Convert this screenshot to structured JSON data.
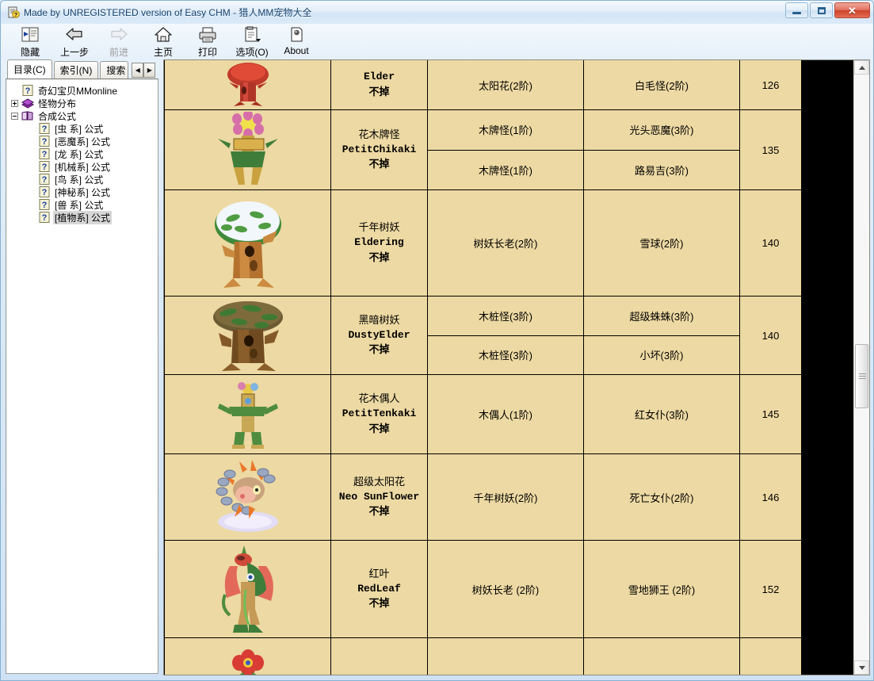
{
  "window": {
    "title": "Made by UNREGISTERED version of Easy CHM - 猎人MM宠物大全",
    "icon": "chm-help-document-icon",
    "buttons": {
      "minimize": "–",
      "maximize": "❐",
      "close": "✕"
    }
  },
  "toolbar": {
    "items": [
      {
        "label": "隐藏",
        "icon": "hide-pane-icon",
        "disabled": false
      },
      {
        "label": "上一步",
        "icon": "back-arrow-icon",
        "disabled": false
      },
      {
        "label": "前进",
        "icon": "forward-arrow-icon",
        "disabled": true
      },
      {
        "label": "主页",
        "icon": "home-icon",
        "disabled": false
      },
      {
        "label": "打印",
        "icon": "printer-icon",
        "disabled": false
      },
      {
        "label": "选项(O)",
        "icon": "options-icon",
        "disabled": false
      },
      {
        "label": "About",
        "icon": "about-page-icon",
        "disabled": false
      }
    ]
  },
  "sidebar": {
    "tabs": [
      {
        "label": "目录(C)",
        "active": true
      },
      {
        "label": "索引(N)",
        "active": false
      },
      {
        "label": "搜索",
        "active": false,
        "clipped": true
      }
    ],
    "tab_scroll_left": "◀",
    "tab_scroll_right": "▶",
    "tree": [
      {
        "label": "奇幻宝贝MMonline",
        "icon": "help-topic-icon",
        "indent": 1,
        "expander": "none",
        "selected": false
      },
      {
        "label": "怪物分布",
        "icon": "closed-book-icon",
        "indent": 0,
        "expander": "plus",
        "selected": false
      },
      {
        "label": "合成公式",
        "icon": "open-book-icon",
        "indent": 0,
        "expander": "minus",
        "selected": false
      },
      {
        "label": "[虫  系] 公式",
        "icon": "help-topic-icon",
        "indent": 2,
        "expander": "none",
        "selected": false
      },
      {
        "label": "[恶魔系] 公式",
        "icon": "help-topic-icon",
        "indent": 2,
        "expander": "none",
        "selected": false
      },
      {
        "label": "[龙  系] 公式",
        "icon": "help-topic-icon",
        "indent": 2,
        "expander": "none",
        "selected": false
      },
      {
        "label": "[机械系] 公式",
        "icon": "help-topic-icon",
        "indent": 2,
        "expander": "none",
        "selected": false
      },
      {
        "label": "[鸟  系] 公式",
        "icon": "help-topic-icon",
        "indent": 2,
        "expander": "none",
        "selected": false
      },
      {
        "label": "[神秘系] 公式",
        "icon": "help-topic-icon",
        "indent": 2,
        "expander": "none",
        "selected": false
      },
      {
        "label": "[兽  系] 公式",
        "icon": "help-topic-icon",
        "indent": 2,
        "expander": "none",
        "selected": false
      },
      {
        "label": "[植物系] 公式",
        "icon": "help-topic-icon",
        "indent": 2,
        "expander": "none",
        "selected": true
      }
    ]
  },
  "content": {
    "page_background": "#EDD9A3",
    "rows": [
      {
        "sprite": "red-tree-monster",
        "name_cn": "",
        "name_en": "Elder",
        "drop": "不掉",
        "level": "126",
        "partial_top": true,
        "recipes": [
          {
            "material_a": "太阳花(2阶)",
            "material_b": "白毛怪(2阶)"
          }
        ]
      },
      {
        "sprite": "flower-sign-monster",
        "name_cn": "花木牌怪",
        "name_en": "PetitChikaki",
        "drop": "不掉",
        "level": "135",
        "partial_top": false,
        "recipes": [
          {
            "material_a": "木牌怪(1阶)",
            "material_b": "光头恶魔(3阶)"
          },
          {
            "material_a": "木牌怪(1阶)",
            "material_b": "路易吉(3阶)"
          }
        ]
      },
      {
        "sprite": "snow-tree-monster",
        "name_cn": "千年树妖",
        "name_en": "Eldering",
        "drop": "不掉",
        "level": "140",
        "partial_top": false,
        "recipes": [
          {
            "material_a": "树妖长老(2阶)",
            "material_b": "雪球(2阶)"
          }
        ]
      },
      {
        "sprite": "dark-tree-monster",
        "name_cn": "黑暗树妖",
        "name_en": "DustyElder",
        "drop": "不掉",
        "level": "140",
        "partial_top": false,
        "recipes": [
          {
            "material_a": "木桩怪(3阶)",
            "material_b": "超级蛛蛛(3阶)"
          },
          {
            "material_a": "木桩怪(3阶)",
            "material_b": "小坏(3阶)"
          }
        ]
      },
      {
        "sprite": "totem-doll-monster",
        "name_cn": "花木偶人",
        "name_en": "PetitTenkaki",
        "drop": "不掉",
        "level": "145",
        "partial_top": false,
        "recipes": [
          {
            "material_a": "木偶人(1阶)",
            "material_b": "红女仆(3阶)"
          }
        ]
      },
      {
        "sprite": "neo-sunflower-monster",
        "name_cn": "超级太阳花",
        "name_en": "Neo SunFlower",
        "drop": "不掉",
        "level": "146",
        "partial_top": false,
        "recipes": [
          {
            "material_a": "千年树妖(2阶)",
            "material_b": "死亡女仆(2阶)"
          }
        ]
      },
      {
        "sprite": "red-leaf-monster",
        "name_cn": "红叶",
        "name_en": "RedLeaf",
        "drop": "不掉",
        "level": "152",
        "partial_top": false,
        "recipes": [
          {
            "material_a": "树妖长老 (2阶)",
            "material_b": "雪地狮王 (2阶)"
          }
        ]
      },
      {
        "sprite": "red-flower-monster",
        "name_cn": "",
        "name_en": "",
        "drop": "",
        "level": "",
        "partial_top": false,
        "partial_bottom": true,
        "recipes": [
          {
            "material_a": "",
            "material_b": ""
          }
        ]
      }
    ]
  },
  "scrollbar": {
    "up_arrow": "▲",
    "down_arrow": "▼",
    "thumb_top_pct": 46,
    "thumb_height_pct": 11
  }
}
